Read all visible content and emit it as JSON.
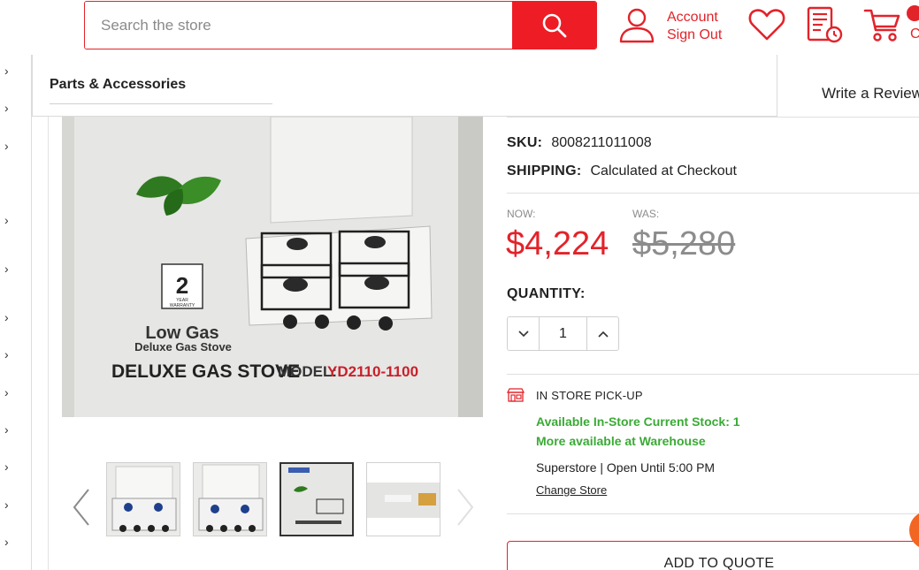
{
  "header": {
    "search_placeholder": "Search the store",
    "account_label": "Account",
    "signout_label": "Sign Out",
    "cart_label_partial": "C",
    "icons": [
      "search-icon",
      "account-icon",
      "heart-icon",
      "quote-list-icon",
      "cart-icon"
    ],
    "accent_color": "#e2232a"
  },
  "dropdown": {
    "item": "Parts & Accessories"
  },
  "review_link": "Write a Review",
  "product": {
    "image_text": {
      "warranty_number": "2",
      "warranty_line1": "YEAR",
      "warranty_line2": "WARRANTY",
      "heading": "Low Gas",
      "subheading": "Deluxe Gas Stove",
      "title": "DELUXE GAS STOVE",
      "model_prefix": "MODEL:",
      "model_code": "YD2110-1100"
    },
    "thumbnails_count": 4,
    "active_thumbnail_index": 2
  },
  "details": {
    "sku_label": "SKU:",
    "sku": "8008211011008",
    "shipping_label": "SHIPPING:",
    "shipping": "Calculated at Checkout",
    "now_label": "NOW:",
    "now_price": "$4,224",
    "was_label": "WAS:",
    "was_price": "$5,280",
    "quantity_label": "QUANTITY:",
    "quantity": "1"
  },
  "pickup": {
    "title": "IN STORE PICK-UP",
    "stock_line": "Available In-Store Current Stock: 1",
    "warehouse_line": "More available at Warehouse",
    "store_hours": "Superstore | Open Until 5:00 PM",
    "change_store": "Change Store",
    "stock_color": "#3aaa35"
  },
  "cta": {
    "add_to_quote": "ADD TO QUOTE"
  }
}
